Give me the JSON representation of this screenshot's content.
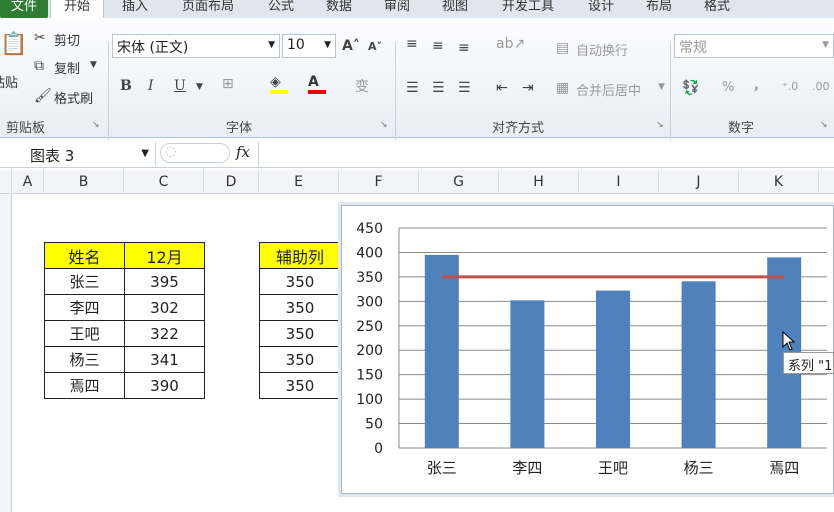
{
  "tabs": [
    "文件",
    "开始",
    "插入",
    "页面布局",
    "公式",
    "数据",
    "审阅",
    "视图",
    "开发工具",
    "设计",
    "布局",
    "格式"
  ],
  "clipboard": {
    "cut": "剪切",
    "copy": "复制",
    "format_painter": "格式刷",
    "paste": "粘贴",
    "group": "剪贴板"
  },
  "font": {
    "name": "宋体 (正文)",
    "size": "10",
    "group": "字体"
  },
  "alignment": {
    "wrap": "自动换行",
    "merge": "合并后居中",
    "group": "对齐方式"
  },
  "number": {
    "format": "常规",
    "percent": "%",
    "comma": ",",
    "group": "数字"
  },
  "formula_bar": {
    "name_box": "图表 3",
    "fx": "fx",
    "formula": ""
  },
  "columns": [
    "A",
    "B",
    "C",
    "D",
    "E",
    "F",
    "G",
    "H",
    "I",
    "J",
    "K"
  ],
  "table1": {
    "headers": [
      "姓名",
      "12月"
    ],
    "rows": [
      [
        "张三",
        "395"
      ],
      [
        "李四",
        "302"
      ],
      [
        "王吧",
        "322"
      ],
      [
        "杨三",
        "341"
      ],
      [
        "焉四",
        "390"
      ]
    ]
  },
  "table2": {
    "header": "辅助列",
    "rows": [
      "350",
      "350",
      "350",
      "350",
      "350"
    ]
  },
  "tooltip": "系列 \"1",
  "chart_data": {
    "type": "bar",
    "categories": [
      "张三",
      "李四",
      "王吧",
      "杨三",
      "焉四"
    ],
    "series": [
      {
        "values": [
          395,
          302,
          322,
          341,
          390
        ],
        "color": "#4f81bd",
        "kind": "bar"
      },
      {
        "values": [
          350,
          350,
          350,
          350,
          350
        ],
        "color": "#c0504d",
        "kind": "line"
      }
    ],
    "ylim": [
      0,
      450
    ],
    "yticks": [
      0,
      50,
      100,
      150,
      200,
      250,
      300,
      350,
      400,
      450
    ],
    "grid": true
  }
}
